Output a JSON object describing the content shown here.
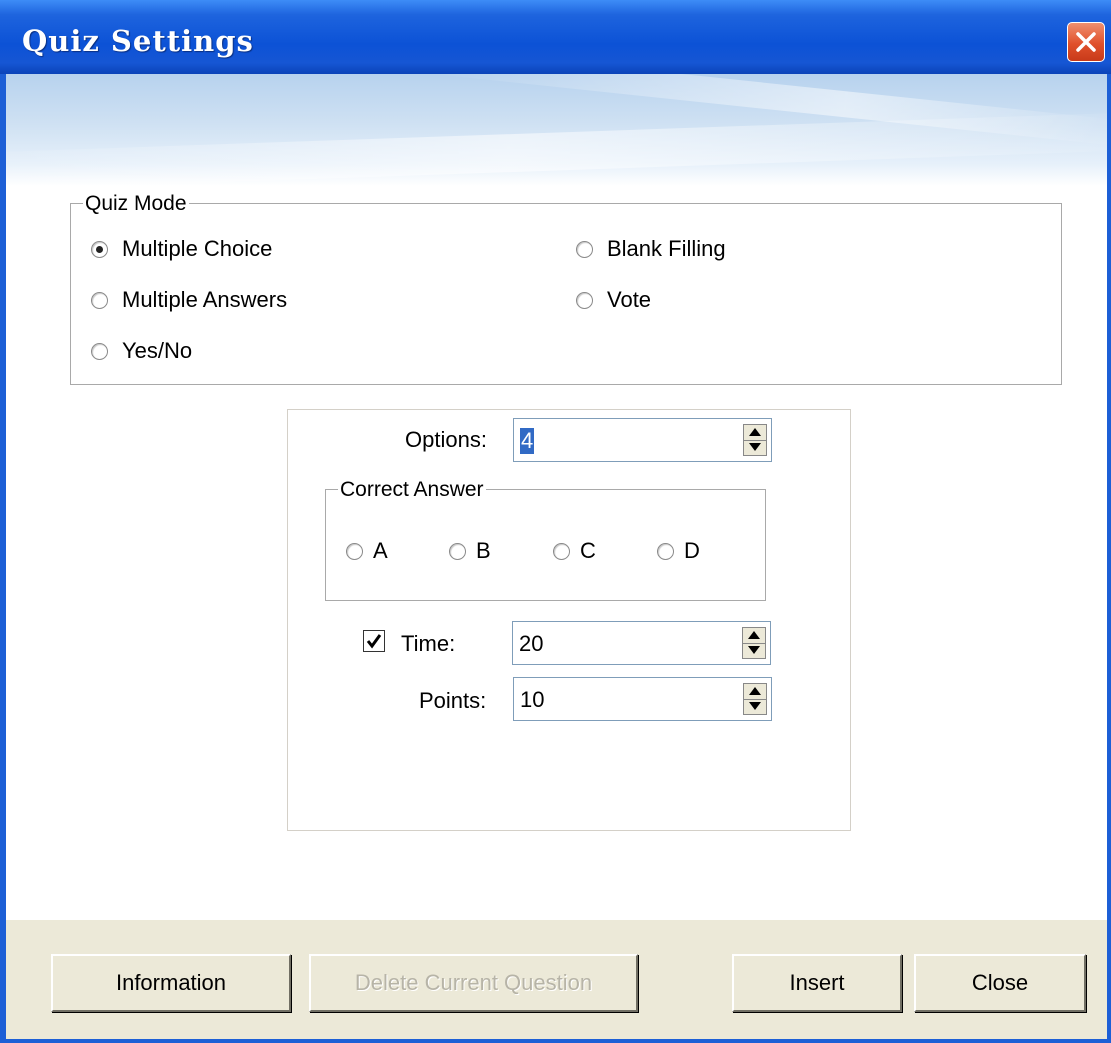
{
  "window": {
    "title": "Quiz Settings"
  },
  "quiz_mode": {
    "legend": "Quiz Mode",
    "options": [
      {
        "label": "Multiple Choice",
        "selected": true
      },
      {
        "label": "Multiple Answers",
        "selected": false
      },
      {
        "label": "Yes/No",
        "selected": false
      },
      {
        "label": "Blank Filling",
        "selected": false
      },
      {
        "label": "Vote",
        "selected": false
      }
    ]
  },
  "options_field": {
    "label": "Options:",
    "value": "4"
  },
  "correct_answer": {
    "legend": "Correct Answer",
    "choices": [
      "A",
      "B",
      "C",
      "D"
    ]
  },
  "time_field": {
    "label": "Time:",
    "checked": true,
    "value": "20"
  },
  "points_field": {
    "label": "Points:",
    "value": "10"
  },
  "buttons": {
    "information": "Information",
    "delete": "Delete Current Question",
    "insert": "Insert",
    "close": "Close"
  }
}
